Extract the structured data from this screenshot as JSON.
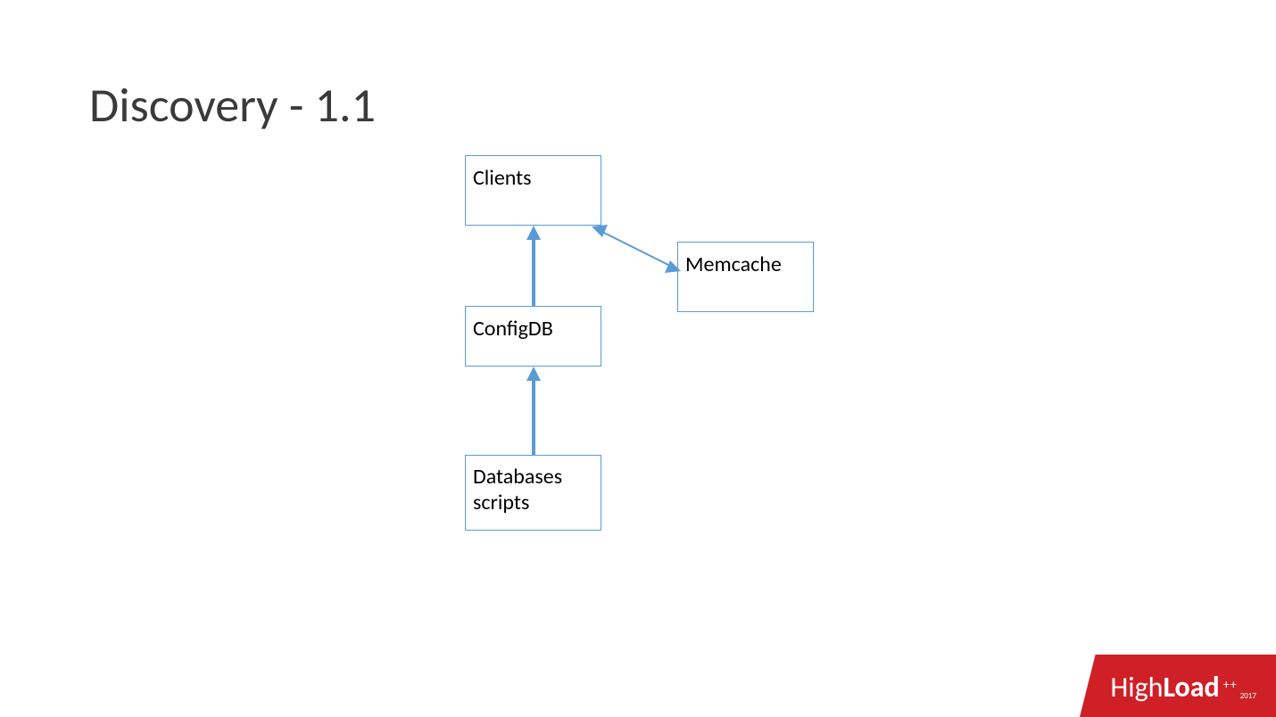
{
  "title": "Discovery - 1.1",
  "boxes": {
    "clients": "Clients",
    "memcache": "Memcache",
    "configdb": "ConfigDB",
    "databases": "Databases scripts"
  },
  "logo": {
    "prefix": "High",
    "bold": "Load",
    "plus": "++",
    "year": "2017"
  },
  "diagram": {
    "nodes": [
      {
        "id": "clients",
        "label": "Clients"
      },
      {
        "id": "memcache",
        "label": "Memcache"
      },
      {
        "id": "configdb",
        "label": "ConfigDB"
      },
      {
        "id": "databases",
        "label": "Databases scripts"
      }
    ],
    "edges": [
      {
        "from": "configdb",
        "to": "clients",
        "direction": "single"
      },
      {
        "from": "databases",
        "to": "configdb",
        "direction": "single"
      },
      {
        "from": "clients",
        "to": "memcache",
        "direction": "bidirectional"
      }
    ]
  }
}
